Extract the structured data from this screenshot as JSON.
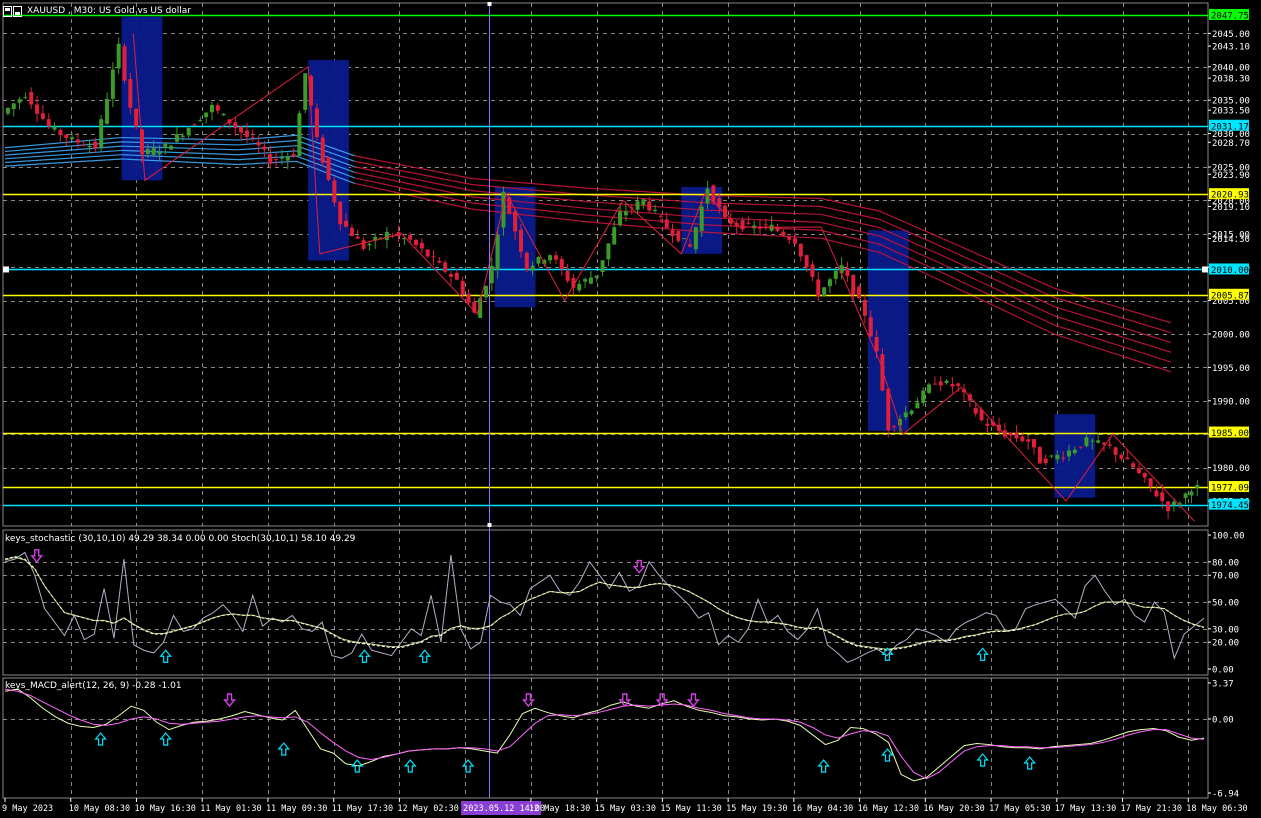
{
  "colors": {
    "background": "#000000",
    "grid": "#c0c0c0",
    "bull_candle": "#3c9a2a",
    "bear_candle": "#e0203a",
    "ema_band_top": "#3fa9f5",
    "ema_band_down": "#c8143c",
    "box_fill": "#0a1a8c",
    "zigzag": "#e0203a",
    "green_line": "#00ff00",
    "cyan_line": "#00e5ff",
    "yellow_line": "#ffff00",
    "stoch_fast": "#b0b0c8",
    "stoch_slow": "#ffffff",
    "macd_main": "#e8ffb0",
    "macd_signal": "#ff66ff",
    "up_arrow": "#00e5ff",
    "down_arrow": "#d040e0",
    "vline": "#9a6bff",
    "time_highlight": "#8a3fd4"
  },
  "chart_title": "XAUUSD , M30:  US Gold vs US dollar",
  "stoch_label": "keys_stochastic (30,10,10) 49.29 38.34 0.00 0.00  Stoch(30,10,1) 58.10 49.29",
  "macd_label": "keys_MACD_alert(12, 26, 9) -0.28 -1.01",
  "chart_data": [
    {
      "type": "line",
      "panel": "price",
      "ylim": [
        1972.5,
        2049.5
      ],
      "y_ticks": [
        "2045.00",
        "2043.10",
        "2040.00",
        "2038.30",
        "2035.00",
        "2033.50",
        "2030.00",
        "2028.70",
        "2025.00",
        "2023.90",
        "2020.00",
        "2019.10",
        "2015.00",
        "2014.30",
        "2010.00",
        "2005.00",
        "2000.00",
        "1995.00",
        "1990.00",
        "1985.00",
        "1980.00",
        "1975.00"
      ],
      "horizontal_lines": [
        {
          "value": 2047.75,
          "label": "2047.75",
          "color": "green"
        },
        {
          "value": 2031.17,
          "label": "2031.17",
          "color": "cyan"
        },
        {
          "value": 2020.93,
          "label": "2020.93",
          "color": "yellow"
        },
        {
          "value": 2009.66,
          "label": "2010.00",
          "color": "cyan"
        },
        {
          "value": 2005.87,
          "label": "2005.87",
          "color": "yellow"
        },
        {
          "value": 1985.25,
          "label": "1985.00",
          "color": "yellow"
        },
        {
          "value": 1977.09,
          "label": "1977.09",
          "color": "yellow"
        },
        {
          "value": 1974.45,
          "label": "1974.45",
          "color": "cyan"
        }
      ],
      "price_path": [
        [
          0,
          2033
        ],
        [
          4,
          2036
        ],
        [
          8,
          2031
        ],
        [
          12,
          2029
        ],
        [
          16,
          2028
        ],
        [
          20,
          2043
        ],
        [
          22,
          2034
        ],
        [
          24,
          2027
        ],
        [
          28,
          2028
        ],
        [
          32,
          2031
        ],
        [
          36,
          2034
        ],
        [
          40,
          2031
        ],
        [
          44,
          2028
        ],
        [
          46,
          2026
        ],
        [
          50,
          2027
        ],
        [
          52,
          2039
        ],
        [
          54,
          2029
        ],
        [
          58,
          2017
        ],
        [
          62,
          2013
        ],
        [
          66,
          2015
        ],
        [
          70,
          2014
        ],
        [
          74,
          2011
        ],
        [
          78,
          2008
        ],
        [
          81,
          2003
        ],
        [
          84,
          2010
        ],
        [
          86,
          2021
        ],
        [
          90,
          2010
        ],
        [
          94,
          2012
        ],
        [
          98,
          2007
        ],
        [
          102,
          2009
        ],
        [
          106,
          2018
        ],
        [
          110,
          2020
        ],
        [
          114,
          2016
        ],
        [
          118,
          2013
        ],
        [
          121,
          2022
        ],
        [
          124,
          2017
        ],
        [
          128,
          2016
        ],
        [
          132,
          2016
        ],
        [
          136,
          2014
        ],
        [
          138,
          2010
        ],
        [
          140,
          2006
        ],
        [
          144,
          2010
        ],
        [
          148,
          2003
        ],
        [
          150,
          1997
        ],
        [
          152,
          1986
        ],
        [
          156,
          1989
        ],
        [
          160,
          1993
        ],
        [
          164,
          1992
        ],
        [
          168,
          1987
        ],
        [
          172,
          1985
        ],
        [
          176,
          1984
        ],
        [
          178,
          1981
        ],
        [
          182,
          1982
        ],
        [
          186,
          1984
        ],
        [
          190,
          1983
        ],
        [
          194,
          1980
        ],
        [
          198,
          1976
        ],
        [
          200,
          1974
        ],
        [
          202,
          1975
        ],
        [
          204,
          1977
        ]
      ],
      "ema_band": [
        [
          0,
          2026.5
        ],
        [
          20,
          2027.8
        ],
        [
          40,
          2027.2
        ],
        [
          50,
          2027.8
        ],
        [
          60,
          2024.6
        ],
        [
          80,
          2021.0
        ],
        [
          100,
          2019.3
        ],
        [
          120,
          2018.0
        ],
        [
          140,
          2017.3
        ],
        [
          150,
          2015.3
        ],
        [
          160,
          2011.4
        ],
        [
          180,
          2003.4
        ],
        [
          200,
          1998.0
        ]
      ],
      "boxes": [
        {
          "from": 20,
          "to": 27,
          "high": 2047.5,
          "low": 2023.0
        },
        {
          "from": 52,
          "to": 59,
          "high": 2041.0,
          "low": 2011.0
        },
        {
          "from": 84,
          "to": 91,
          "high": 2022.0,
          "low": 2004.0
        },
        {
          "from": 116,
          "to": 123,
          "high": 2022.0,
          "low": 2012.0
        },
        {
          "from": 148,
          "to": 155,
          "high": 2015.5,
          "low": 1985.5
        },
        {
          "from": 180,
          "to": 187,
          "high": 1988.0,
          "low": 1975.5
        }
      ],
      "zigzag": [
        [
          22,
          2045
        ],
        [
          24,
          2023
        ],
        [
          52,
          2040
        ],
        [
          54,
          2012
        ],
        [
          68,
          2015
        ],
        [
          81,
          2003
        ],
        [
          86,
          2021
        ],
        [
          96,
          2005
        ],
        [
          106,
          2020
        ],
        [
          116,
          2012
        ],
        [
          120,
          2021
        ],
        [
          126,
          2016
        ],
        [
          140,
          2016
        ],
        [
          150,
          1996
        ],
        [
          154,
          1985
        ],
        [
          164,
          1992
        ],
        [
          182,
          1975
        ],
        [
          190,
          1985
        ],
        [
          204,
          1972
        ]
      ],
      "vertical_marker_index": 83
    },
    {
      "type": "line",
      "panel": "stochastic",
      "ylim": [
        -2,
        104
      ],
      "y_ticks": [
        "100.00",
        "80.00",
        "70.00",
        "50.00",
        "30.00",
        "20.00",
        "0.00"
      ],
      "series": [
        {
          "values": [
            80,
            82,
            87,
            70,
            45,
            35,
            25,
            40,
            22,
            26,
            60,
            23,
            82,
            18,
            14,
            12,
            20,
            40,
            28,
            30,
            38,
            42,
            48,
            40,
            28,
            55,
            32,
            38,
            35,
            40,
            30,
            28,
            35,
            10,
            8,
            12,
            26,
            14,
            12,
            10,
            20,
            30,
            25,
            55,
            20,
            85,
            30,
            15,
            20,
            55,
            50,
            48,
            40,
            60,
            65,
            70,
            58,
            55,
            65,
            80,
            70,
            60,
            72,
            58,
            62,
            80,
            70,
            62,
            55,
            48,
            38,
            42,
            18,
            25,
            20,
            30,
            52,
            34,
            40,
            28,
            22,
            30,
            45,
            18,
            12,
            5,
            8,
            12,
            15,
            10,
            18,
            22,
            30,
            28,
            25,
            20,
            30,
            35,
            38,
            42,
            40,
            28,
            30,
            45,
            48,
            50,
            52,
            45,
            38,
            62,
            70,
            58,
            48,
            52,
            40,
            35,
            50,
            42,
            8,
            26,
            32,
            38
          ]
        },
        {
          "values": [
            82,
            84,
            82,
            75,
            62,
            52,
            42,
            40,
            38,
            36,
            36,
            34,
            38,
            33,
            29,
            26,
            26,
            28,
            30,
            32,
            35,
            38,
            40,
            41,
            40,
            40,
            38,
            37,
            36,
            36,
            34,
            32,
            30,
            26,
            22,
            20,
            19,
            18,
            17,
            16,
            16,
            18,
            20,
            24,
            25,
            30,
            32,
            30,
            30,
            32,
            38,
            42,
            48,
            52,
            55,
            58,
            57,
            57,
            58,
            62,
            65,
            63,
            62,
            61,
            61,
            63,
            64,
            63,
            61,
            58,
            54,
            50,
            45,
            41,
            38,
            36,
            35,
            35,
            34,
            33,
            31,
            30,
            31,
            28,
            24,
            20,
            17,
            16,
            15,
            14,
            15,
            16,
            18,
            20,
            21,
            21,
            22,
            24,
            25,
            27,
            28,
            28,
            29,
            31,
            33,
            36,
            39,
            41,
            41,
            43,
            47,
            50,
            50,
            50,
            48,
            46,
            46,
            45,
            40,
            36,
            33,
            31
          ]
        }
      ]
    },
    {
      "type": "line",
      "panel": "macd",
      "ylim": [
        -6.94,
        3.37
      ],
      "y_ticks": [
        "3.37",
        "0.00",
        "-6.94"
      ],
      "series": [
        {
          "values": [
            2.6,
            2.8,
            2.0,
            1.0,
            0.2,
            -0.4,
            -0.7,
            -0.8,
            -0.5,
            0.3,
            1.2,
            0.8,
            -0.3,
            -1.0,
            -0.6,
            -0.3,
            -0.2,
            0.0,
            0.3,
            0.7,
            0.4,
            0.1,
            -0.1,
            0.8,
            -1.0,
            -2.8,
            -3.2,
            -4.2,
            -4.4,
            -4.0,
            -3.5,
            -3.3,
            -3.0,
            -2.9,
            -2.8,
            -2.8,
            -2.7,
            -2.8,
            -3.0,
            -3.2,
            -1.5,
            0.5,
            1.0,
            0.6,
            0.3,
            0.1,
            0.5,
            0.8,
            1.3,
            1.6,
            1.2,
            1.0,
            1.4,
            1.7,
            1.2,
            0.8,
            0.6,
            0.3,
            0.2,
            0.0,
            -0.1,
            0.0,
            -0.2,
            -0.6,
            -1.5,
            -2.4,
            -2.0,
            -0.8,
            -0.9,
            -1.4,
            -2.2,
            -5.2,
            -5.8,
            -5.5,
            -4.5,
            -3.5,
            -2.5,
            -2.3,
            -2.4,
            -2.6,
            -2.7,
            -2.7,
            -2.8,
            -2.6,
            -2.5,
            -2.4,
            -2.3,
            -2.0,
            -1.6,
            -1.2,
            -1.0,
            -0.9,
            -1.1,
            -1.7,
            -2.0,
            -1.8
          ]
        },
        {
          "values": [
            2.8,
            2.6,
            2.2,
            1.6,
            1.0,
            0.4,
            -0.1,
            -0.5,
            -0.6,
            -0.4,
            0.0,
            0.2,
            0.0,
            -0.4,
            -0.5,
            -0.4,
            -0.3,
            -0.2,
            0.0,
            0.2,
            0.3,
            0.2,
            0.1,
            0.2,
            -0.3,
            -1.3,
            -2.2,
            -3.0,
            -3.6,
            -3.8,
            -3.6,
            -3.3,
            -3.0,
            -2.9,
            -2.8,
            -2.8,
            -2.7,
            -2.7,
            -2.8,
            -3.0,
            -2.6,
            -1.5,
            -0.4,
            0.3,
            0.4,
            0.3,
            0.4,
            0.6,
            0.9,
            1.2,
            1.3,
            1.2,
            1.3,
            1.4,
            1.3,
            1.0,
            0.8,
            0.5,
            0.3,
            0.1,
            0.0,
            0.0,
            -0.1,
            -0.3,
            -0.8,
            -1.5,
            -1.8,
            -1.4,
            -1.1,
            -1.2,
            -1.6,
            -3.5,
            -5.0,
            -5.6,
            -5.0,
            -4.0,
            -3.0,
            -2.6,
            -2.5,
            -2.5,
            -2.6,
            -2.6,
            -2.7,
            -2.7,
            -2.6,
            -2.5,
            -2.4,
            -2.2,
            -1.9,
            -1.5,
            -1.2,
            -1.0,
            -1.0,
            -1.4,
            -1.8,
            -1.9
          ]
        }
      ]
    }
  ],
  "time_labels": [
    "9 May 2023",
    "10 May 08:30",
    "10 May 16:30",
    "11 May 01:30",
    "11 May 09:30",
    "11 May 17:30",
    "12 May 02:30",
    "2023.05.12 14:00",
    "12 May 18:30",
    "15 May 03:30",
    "15 May 11:30",
    "15 May 19:30",
    "16 May 04:30",
    "16 May 12:30",
    "16 May 20:30",
    "17 May 05:30",
    "17 May 13:30",
    "17 May 21:30",
    "18 May 06:30"
  ],
  "highlighted_time": "2023.05.12 14:00",
  "stoch_up_arrows": [
    0.135,
    0.3,
    0.35,
    0.734,
    0.813
  ],
  "stoch_down_arrows": [
    0.028,
    0.528
  ],
  "macd_up_arrows": [
    0.081,
    0.135,
    0.233,
    0.294,
    0.338,
    0.386,
    0.681,
    0.734,
    0.813,
    0.852
  ],
  "macd_down_arrows": [
    0.188,
    0.436,
    0.516,
    0.547,
    0.573
  ]
}
